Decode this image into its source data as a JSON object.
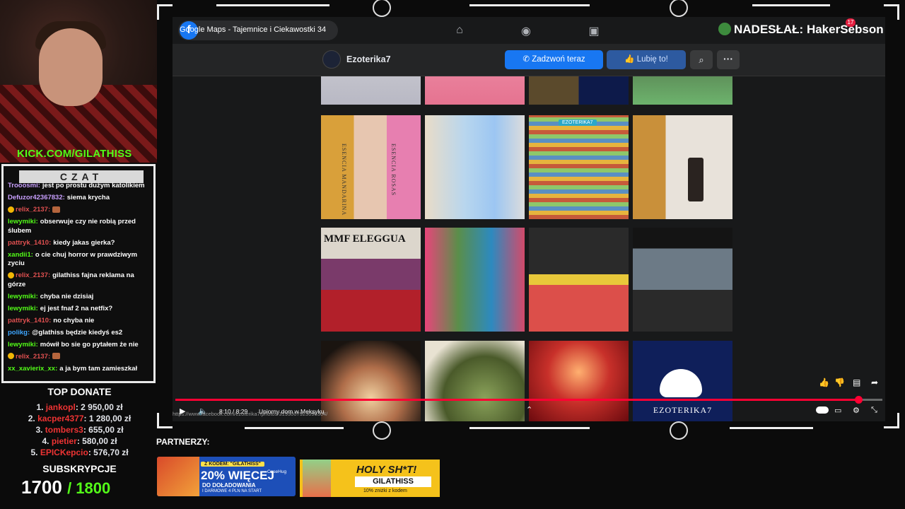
{
  "stream": {
    "kick_label": "KICK.COM/GILATHISS",
    "chat_title": "CZAT",
    "chat_messages": [
      {
        "user": "Trooosmi:",
        "text": "jest po prostu dużym katolikiem",
        "color": "#c9a0ff"
      },
      {
        "user": "Defuzor42367832:",
        "text": "siema krycha",
        "color": "#c9a0ff"
      },
      {
        "user": "relix_2137:",
        "text": "",
        "color": "#e05050"
      },
      {
        "user": "lewymiki:",
        "text": "obserwuje czy nie robią przed ślubem",
        "color": "#53fc18"
      },
      {
        "user": "pattryk_1410:",
        "text": "kiedy jakas gierka?",
        "color": "#e05050"
      },
      {
        "user": "xandii1:",
        "text": "o cie chuj horror w prawdziwym zyciu",
        "color": "#53fc18"
      },
      {
        "user": "relix_2137:",
        "text": "gilathiss fajna reklama na górze",
        "color": "#e05050"
      },
      {
        "user": "lewymiki:",
        "text": "chyba nie dzisiaj",
        "color": "#53fc18"
      },
      {
        "user": "lewymiki:",
        "text": "ej jest fnaf 2 na netfix?",
        "color": "#53fc18"
      },
      {
        "user": "pattryk_1410:",
        "text": "no chyba nie",
        "color": "#e05050"
      },
      {
        "user": "polikg:",
        "text": "@glathiss będzie kiedyś es2",
        "color": "#3ea6ff"
      },
      {
        "user": "lewymiki:",
        "text": "mówił bo sie go pytałem że nie",
        "color": "#53fc18"
      },
      {
        "user": "relix_2137:",
        "text": "",
        "color": "#e05050"
      },
      {
        "user": "xx_xavierix_xx:",
        "text": "a ja bym tam zamieszkał",
        "color": "#53fc18"
      }
    ],
    "top_donate_title": "TOP DONATE",
    "donations": [
      {
        "rank": "1.",
        "name": "jankopl",
        "amount": "2 950,00 zł"
      },
      {
        "rank": "2.",
        "name": "kacper4377",
        "amount": "1 280,00 zł"
      },
      {
        "rank": "3.",
        "name": "tombers3",
        "amount": "655,00 zł"
      },
      {
        "rank": "4.",
        "name": "pietier",
        "amount": "580,00 zł"
      },
      {
        "rank": "5.",
        "name": "EPICKepcio",
        "amount": "576,70 zł"
      }
    ],
    "subs_title": "SUBSKRYPCJE",
    "subs_current": "1700",
    "subs_goal": "/ 1800",
    "nadeslal": "NADESŁAŁ: HakerSebson",
    "partners_label": "PARTNERZY:",
    "banner1": {
      "code": "Z KODEM: \"GILATHISS\"",
      "big": "20% WIĘCEJ",
      "line2": "DO DOŁADOWANIA",
      "line3": "I DARMOWE 4 PLN NA START",
      "brand": "CaseHug"
    },
    "banner2": {
      "big": "HOLY SH*T!",
      "code": "GILATHISS",
      "small": "10% zniżki z kodem"
    }
  },
  "video": {
    "title": "Google Maps - Tajemnice i Ciekawostki 34",
    "time": "8:10 / 8:29",
    "chapter": "Upiorny dom w Meksyku",
    "url": "https://www.facebook.com/ezoterika7/photos/3193007923096304/",
    "progress": 0.966,
    "notification_count": "17"
  },
  "facebook": {
    "page_name": "Ezoterika7",
    "call_button": "Zadzwoń teraz",
    "like_button": "Lubię to!",
    "photo_labels": {
      "esencia_mandarina": "ESENCIA MANDARINA",
      "esencia_rosas": "ESENCIA ROSAS",
      "tag_ezoterika": "EZOTERIKA7",
      "mmf_eleggua": "MMF ELEGGUA",
      "ezoterika_logo": "EZOTERIKA7"
    }
  },
  "colors": {
    "kick_green": "#53fc18",
    "fb_blue": "#1877f2",
    "progress_red": "#ff0033"
  }
}
